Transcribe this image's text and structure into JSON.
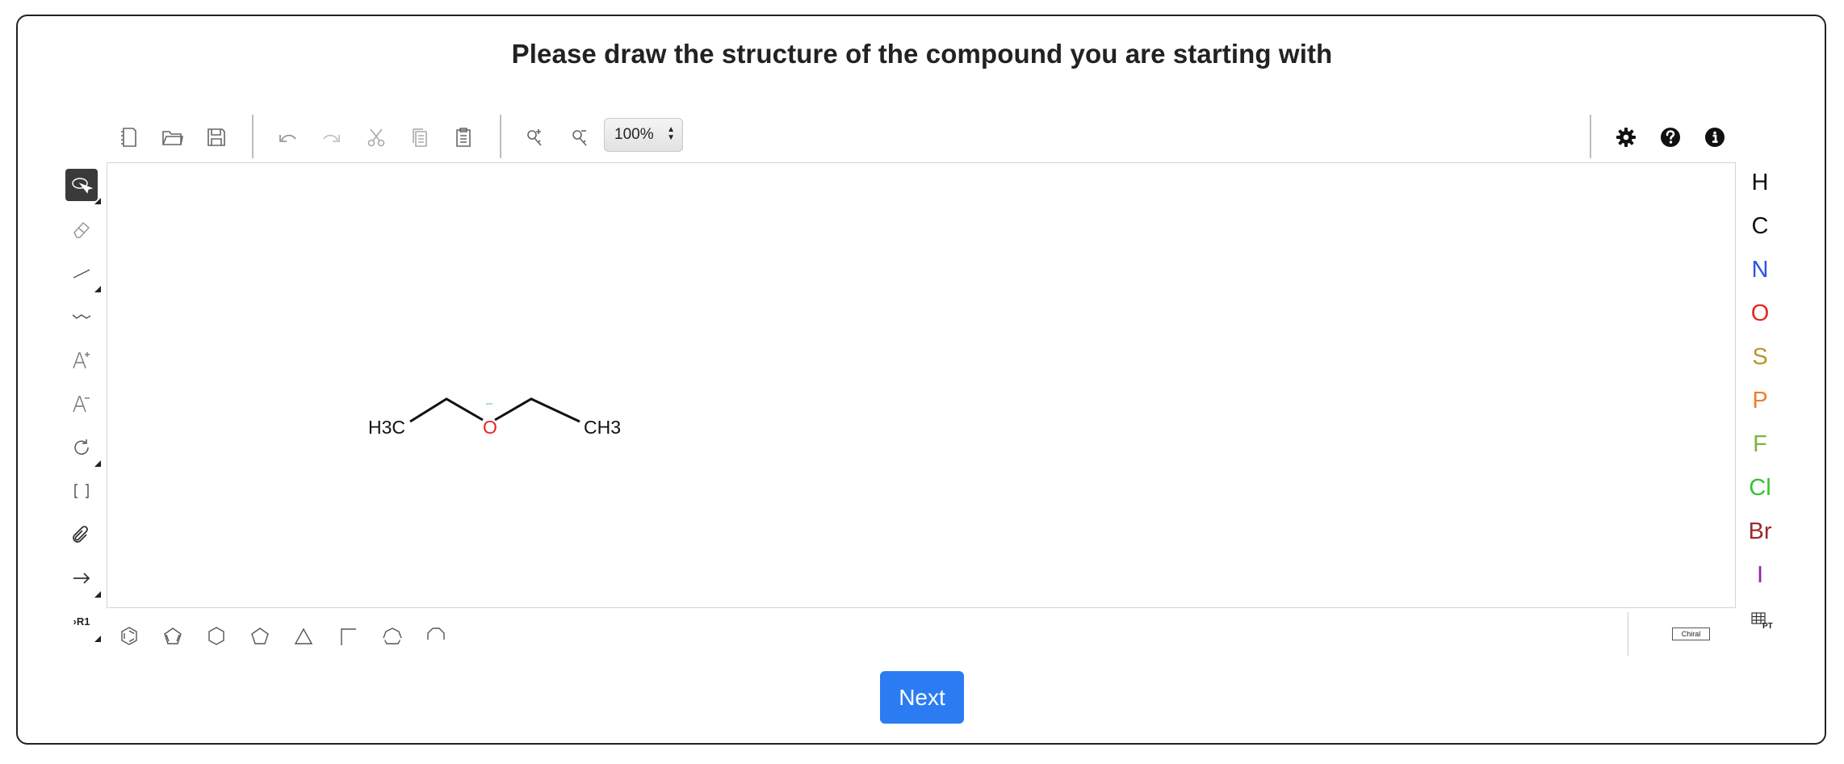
{
  "page": {
    "title": "Please draw the structure of the compound you are starting with"
  },
  "toolbar": {
    "zoom_value": "100%",
    "zoom_arrows": "▲▼"
  },
  "left_tools": {
    "rgroup_label": "R1"
  },
  "canvas": {
    "molecule": {
      "left_label": "H3C",
      "oxygen_label": "O",
      "right_label": "CH3",
      "oxygen_color": "#e4261f"
    }
  },
  "elements": [
    {
      "symbol": "H",
      "color": "#111111"
    },
    {
      "symbol": "C",
      "color": "#111111"
    },
    {
      "symbol": "N",
      "color": "#2f53e5"
    },
    {
      "symbol": "O",
      "color": "#e4261f"
    },
    {
      "symbol": "S",
      "color": "#b8962c"
    },
    {
      "symbol": "P",
      "color": "#f07e2c"
    },
    {
      "symbol": "F",
      "color": "#7cb342"
    },
    {
      "symbol": "Cl",
      "color": "#33c233"
    },
    {
      "symbol": "Br",
      "color": "#9c2a2a"
    },
    {
      "symbol": "I",
      "color": "#8e24aa"
    }
  ],
  "periodic_table_label": "PT",
  "bottom": {
    "chiral_label": "Chiral"
  },
  "actions": {
    "next_label": "Next"
  },
  "colors": {
    "accent": "#2b7cf2"
  }
}
